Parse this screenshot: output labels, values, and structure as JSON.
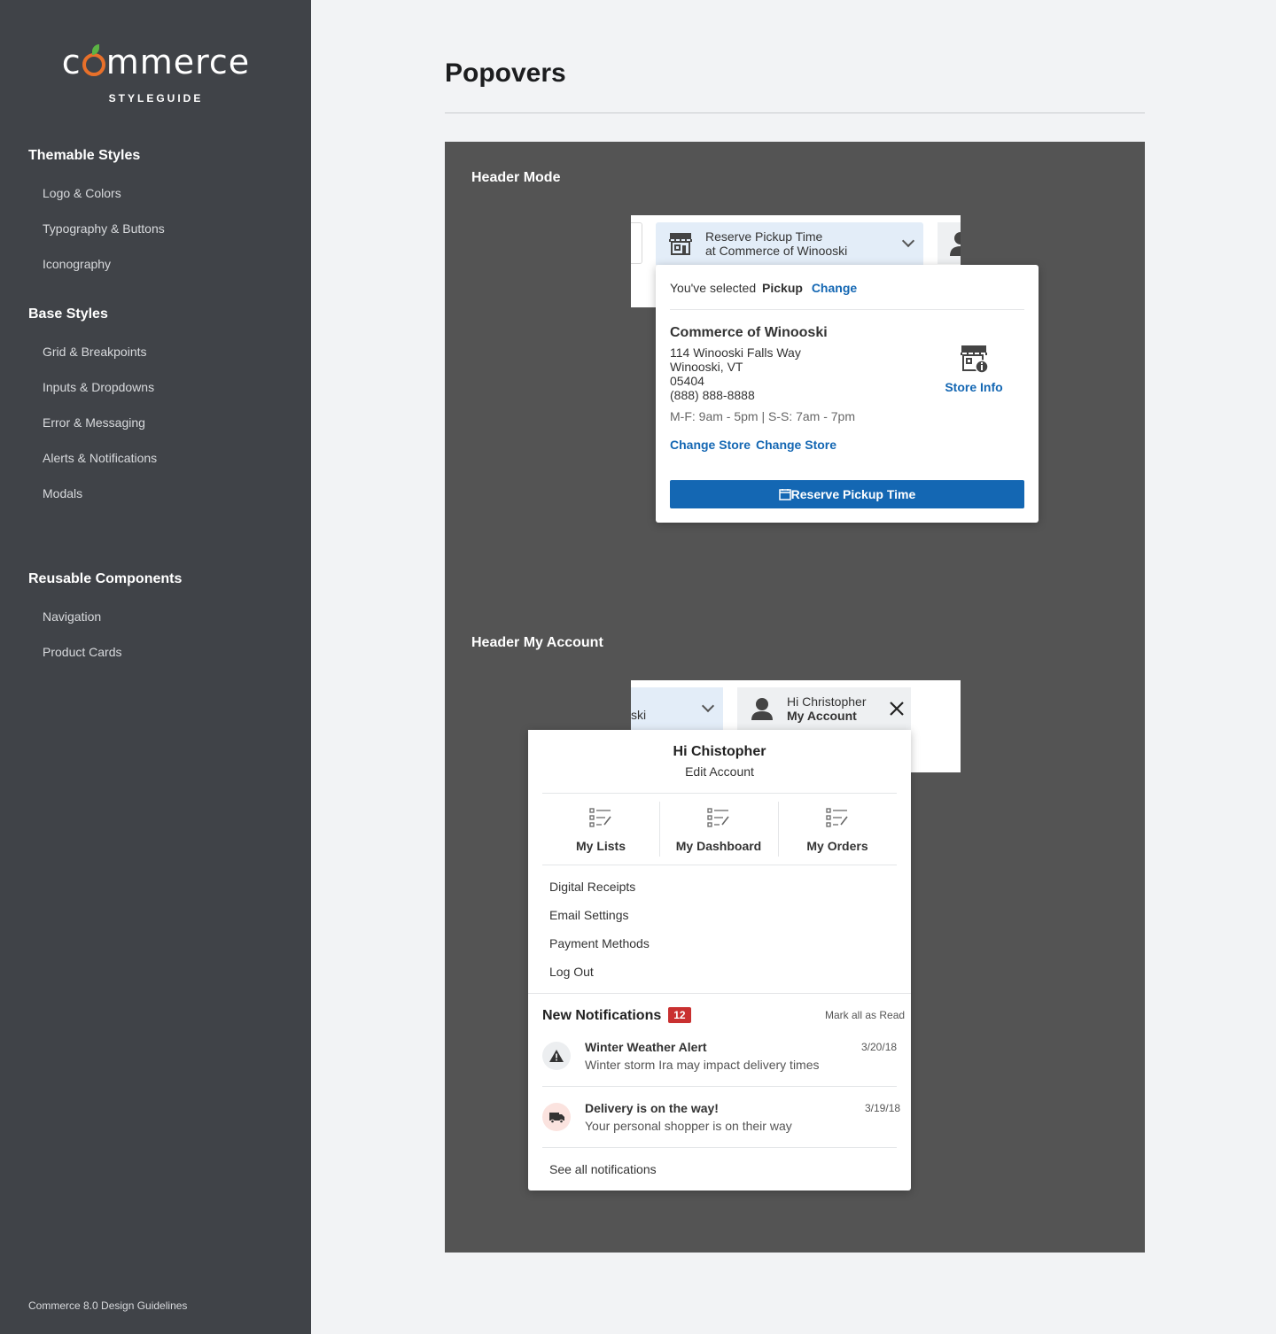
{
  "sidebar": {
    "logo_text_pre": "c",
    "logo_text_post": "mmerce",
    "logo_sub": "STYLEGUIDE",
    "sections": [
      {
        "label": "Themable Styles",
        "items": [
          "Logo & Colors",
          "Typography & Buttons",
          "Iconography"
        ]
      },
      {
        "label": "Base Styles",
        "items": [
          "Grid & Breakpoints",
          "Inputs & Dropdowns",
          "Error & Messaging",
          "Alerts & Notifications",
          "Modals"
        ]
      },
      {
        "label": "Reusable Components",
        "items": [
          "Navigation",
          "Product Cards"
        ]
      }
    ],
    "footer": "Commerce 8.0 Design Guidelines"
  },
  "page": {
    "title": "Popovers"
  },
  "header_mode": {
    "label": "Header Mode",
    "pill_line1": "Reserve Pickup Time",
    "pill_line2": "at Commerce of Winooski",
    "popover": {
      "selected_prefix": "You've selected",
      "selected_mode": "Pickup",
      "change_link": "Change",
      "store_name": "Commerce of Winooski",
      "address1": "114 Winooski Falls Way",
      "address2": "Winooski, VT",
      "zip": "05404",
      "phone": "(888) 888-8888",
      "hours": "M-F: 9am - 5pm | S-S: 7am - 7pm",
      "change_store_1": "Change Store",
      "change_store_2": "Change Store",
      "store_info": "Store Info",
      "reserve_button": "Reserve Pickup Time"
    }
  },
  "header_account": {
    "label": "Header My Account",
    "left_pill_text": "ski",
    "greeting_small": "Hi Christopher",
    "my_account": "My Account",
    "popover": {
      "greeting": "Hi Chistopher",
      "edit_account": "Edit Account",
      "tiles": [
        "My Lists",
        "My Dashboard",
        "My Orders"
      ],
      "links": [
        "Digital Receipts",
        "Email Settings",
        "Payment Methods",
        "Log Out"
      ],
      "notifications_title": "New Notifications",
      "notifications_count": "12",
      "mark_all": "Mark all as Read",
      "notifications": [
        {
          "title": "Winter Weather Alert",
          "body": "Winter storm Ira may impact delivery times",
          "date": "3/20/18",
          "icon": "warning-icon"
        },
        {
          "title": "Delivery is on the way!",
          "body": "Your personal shopper is on their way",
          "date": "3/19/18",
          "icon": "truck-icon"
        }
      ],
      "see_all": "See all notifications"
    }
  },
  "colors": {
    "accent": "#1467b3",
    "sidebar": "#404348",
    "badge": "#c93030",
    "logo_orange": "#e8702a"
  }
}
